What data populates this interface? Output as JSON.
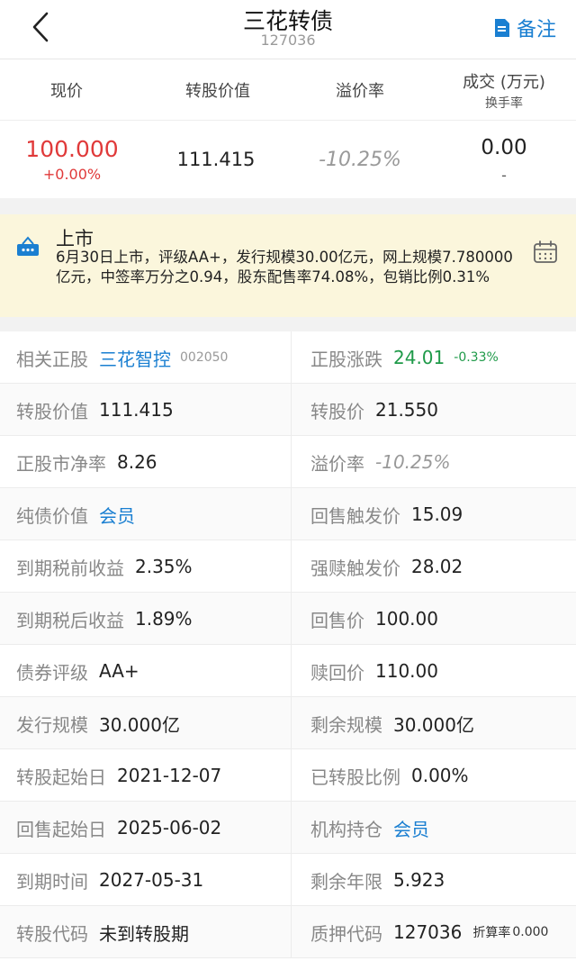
{
  "nav": {
    "title": "三花转债",
    "code": "127036",
    "note_label": "备注",
    "colors": {
      "accent": "#1a7fd1"
    }
  },
  "quote_headers": {
    "price": "现价",
    "conv_value": "转股价值",
    "premium": "溢价率",
    "volume": "成交 (万元)",
    "turnover": "换手率"
  },
  "quote_values": {
    "price": "100.000",
    "change": "+0.00%",
    "conv_value": "111.415",
    "premium": "-10.25%",
    "volume": "0.00",
    "turnover": "-"
  },
  "banner": {
    "title": "上市",
    "text": "6月30日上市，评级AA+，发行规模30.00亿元，网上规模7.780000亿元，中签率万分之0.94，股东配售率74.08%，包销比例0.31%",
    "background": "#fbf6dc"
  },
  "rows": [
    {
      "left": {
        "label": "相关正股",
        "value": "三花智控",
        "sub": "002050"
      },
      "right": {
        "label": "正股涨跌",
        "value": "24.01",
        "sub": "-0.33%"
      }
    },
    {
      "left": {
        "label": "转股价值",
        "value": "111.415"
      },
      "right": {
        "label": "转股价",
        "value": "21.550"
      }
    },
    {
      "left": {
        "label": "正股市净率",
        "value": "8.26"
      },
      "right": {
        "label": "溢价率",
        "value": "-10.25%"
      }
    },
    {
      "left": {
        "label": "纯债价值",
        "value": "会员"
      },
      "right": {
        "label": "回售触发价",
        "value": "15.09"
      }
    },
    {
      "left": {
        "label": "到期税前收益",
        "value": "2.35%"
      },
      "right": {
        "label": "强赎触发价",
        "value": "28.02"
      }
    },
    {
      "left": {
        "label": "到期税后收益",
        "value": "1.89%"
      },
      "right": {
        "label": "回售价",
        "value": "100.00"
      }
    },
    {
      "left": {
        "label": "债券评级",
        "value": "AA+"
      },
      "right": {
        "label": "赎回价",
        "value": "110.00"
      }
    },
    {
      "left": {
        "label": "发行规模",
        "value": "30.000亿"
      },
      "right": {
        "label": "剩余规模",
        "value": "30.000亿"
      }
    },
    {
      "left": {
        "label": "转股起始日",
        "value": "2021-12-07"
      },
      "right": {
        "label": "已转股比例",
        "value": "0.00%"
      }
    },
    {
      "left": {
        "label": "回售起始日",
        "value": "2025-06-02"
      },
      "right": {
        "label": "机构持仓",
        "value": "会员"
      }
    },
    {
      "left": {
        "label": "到期时间",
        "value": "2027-05-31"
      },
      "right": {
        "label": "剩余年限",
        "value": "5.923"
      }
    },
    {
      "left": {
        "label": "转股代码",
        "value": "未到转股期"
      },
      "right": {
        "label": "质押代码",
        "value": "127036",
        "extra_label": "折算率",
        "extra_value": "0.000"
      }
    }
  ],
  "colors": {
    "up": "#e03a3a",
    "down": "#1f9a49",
    "link": "#1a7fd1"
  }
}
